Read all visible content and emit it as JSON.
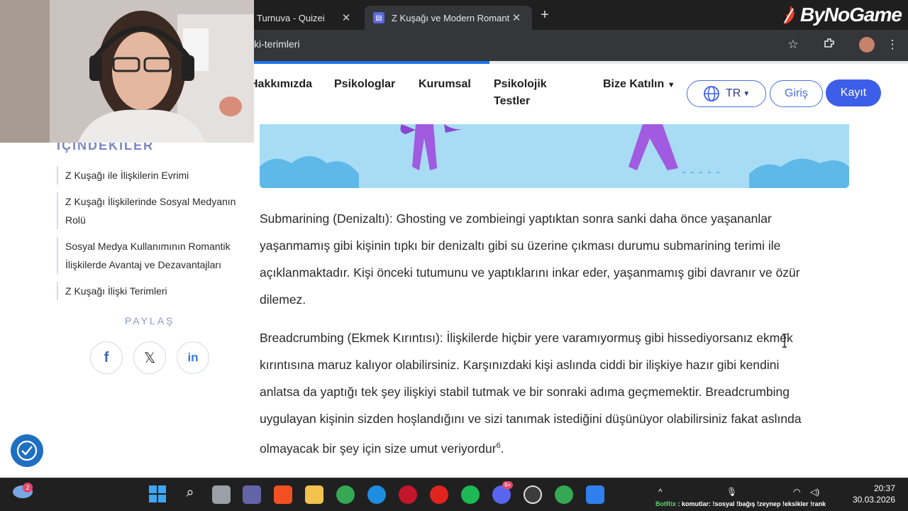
{
  "browser": {
    "tabs": [
      {
        "title": "Turnuva - Quizei",
        "active": false
      },
      {
        "title": "Z Kuşağı ve Modern Romantik İl",
        "active": true
      }
    ],
    "new_tab_label": "+",
    "close_label": "✕",
    "url": "ki-terimleri",
    "brand_text": "ByNoGame",
    "load_progress": 0.36
  },
  "site_nav": {
    "items": [
      "Hakkımızda",
      "Psikologlar",
      "Kurumsal",
      "Psikolojik",
      "Testler",
      "Bize Katılın"
    ],
    "language": "TR",
    "login_label": "Giriş",
    "register_label": "Kayıt"
  },
  "sidebar": {
    "title": "İÇİNDEKİLER",
    "toc": [
      "Z Kuşağı ile İlişkilerin Evrimi",
      "Z Kuşağı İlişkilerinde Sosyal Medyanın",
      "Rolü",
      "Sosyal Medya Kullanımının Romantik",
      "İlişkilerde Avantaj ve Dezavantajları",
      "Z Kuşağı İlişki Terimleri"
    ],
    "share_label": "PAYLAŞ",
    "social": [
      "facebook-icon",
      "x-icon",
      "linkedin-icon"
    ]
  },
  "article": {
    "p1": [
      "Submarining (Denizaltı): Ghosting ve zombieingi yaptıktan sonra sanki daha önce yaşananlar",
      "yaşanmamış gibi kişinin tıpkı bir denizaltı gibi su üzerine çıkması durumu submarining terimi ile",
      "açıklanmaktadır. Kişi önceki tutumunu ve yaptıklarını inkar eder, yaşanmamış gibi davranır ve özür",
      "dilemez."
    ],
    "p2": [
      "Breadcrumbing (Ekmek Kırıntısı): İlişkilerde hiçbir yere varamıyormuş gibi hissediyorsanız ekmek",
      "kırıntısına maruz kalıyor olabilirsiniz. Karşınızdaki kişi aslında ciddi bir ilişkiye hazır gibi kendini",
      "anlatsa da yaptığı tek şey ilişkiyi stabil tutmak ve bir sonraki adıma geçmemektir. Breadcrumbing",
      "uygulayan kişinin sizden hoşlandığını ve sizi tanımak istediğini düşünüyor olabilirsiniz fakat aslında",
      "olmayacak bir şey için size umut veriyordur"
    ],
    "p2_sup": "6",
    "p2_end": "."
  },
  "taskbar": {
    "weather_badge": "2",
    "discord_badge": "9+",
    "ticker_user": "BotRix",
    "ticker_text": ": komutlar: !sosyal !bağış !zeynep !eksikler !rank",
    "time": "20:37",
    "date": "30.03.2026"
  }
}
